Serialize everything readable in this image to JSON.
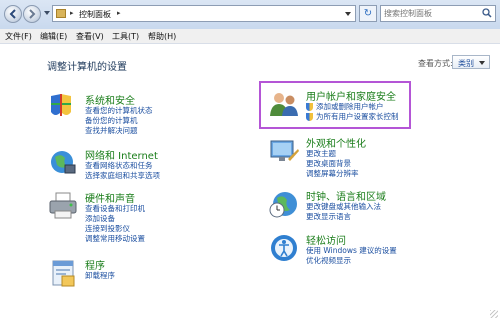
{
  "address_bar": {
    "breadcrumb": "控制面板",
    "search_placeholder": "搜索控制面板"
  },
  "menu": [
    "文件(F)",
    "编辑(E)",
    "查看(V)",
    "工具(T)",
    "帮助(H)"
  ],
  "main": {
    "heading": "调整计算机的设置",
    "view_by_label": "查看方式:",
    "view_by_value": "类别"
  },
  "categories": [
    {
      "title": "系统和安全",
      "icon": "shield-flag-icon",
      "links": [
        "查看您的计算机状态",
        "备份您的计算机",
        "查找并解决问题"
      ]
    },
    {
      "title": "网络和 Internet",
      "icon": "network-globe-icon",
      "links": [
        "查看网络状态和任务",
        "选择家庭组和共享选项"
      ]
    },
    {
      "title": "硬件和声音",
      "icon": "printer-icon",
      "links": [
        "查看设备和打印机",
        "添加设备",
        "连接到投影仪",
        "调整常用移动设置"
      ]
    },
    {
      "title": "程序",
      "icon": "programs-icon",
      "links": [
        "卸载程序"
      ]
    },
    {
      "title": "用户帐户和家庭安全",
      "icon": "users-icon",
      "links": [
        "添加或删除用户帐户",
        "为所有用户设置家长控制"
      ]
    },
    {
      "title": "外观和个性化",
      "icon": "appearance-icon",
      "links": [
        "更改主题",
        "更改桌面背景",
        "调整屏幕分辨率"
      ]
    },
    {
      "title": "时钟、语言和区域",
      "icon": "clock-globe-icon",
      "links": [
        "更改键盘或其他输入法",
        "更改显示语言"
      ]
    },
    {
      "title": "轻松访问",
      "icon": "ease-of-access-icon",
      "links": [
        "使用 Windows 建议的设置",
        "优化视频显示"
      ]
    }
  ]
}
